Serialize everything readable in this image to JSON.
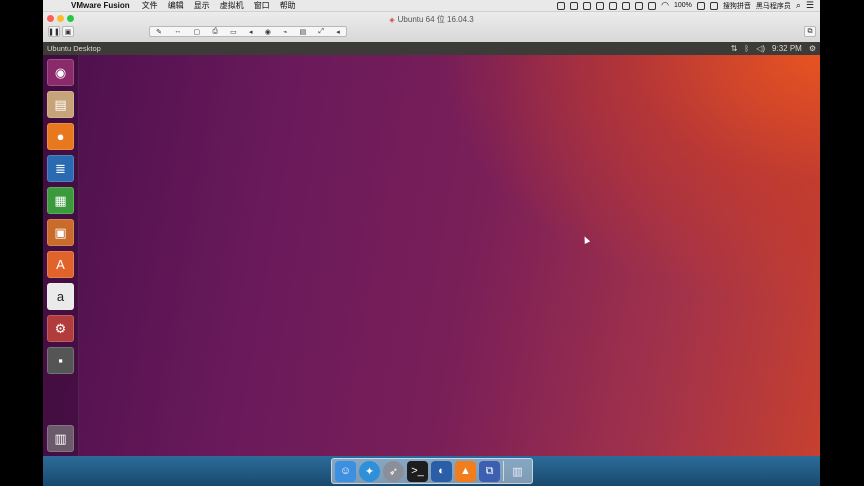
{
  "mac_menubar": {
    "apple_icon": "apple-icon",
    "app_name": "VMware Fusion",
    "menu_items": [
      "文件",
      "编辑",
      "显示",
      "虚拟机",
      "窗口",
      "帮助"
    ],
    "battery": "100%",
    "input_method": "搜狗拼音",
    "username": "黑马程序员"
  },
  "window": {
    "title": "Ubuntu 64 位 16.04.3"
  },
  "ubuntu_panel": {
    "title": "Ubuntu Desktop",
    "clock": "9:32 PM"
  },
  "launcher": {
    "items": [
      {
        "name": "dash-icon",
        "glyph": "◉",
        "bg": "#8a2a6a"
      },
      {
        "name": "files-icon",
        "glyph": "▤",
        "bg": "#c7a37a"
      },
      {
        "name": "firefox-icon",
        "glyph": "●",
        "bg": "#e8781e"
      },
      {
        "name": "writer-icon",
        "glyph": "≣",
        "bg": "#2a6ab0"
      },
      {
        "name": "calc-icon",
        "glyph": "▦",
        "bg": "#3b9a3b"
      },
      {
        "name": "impress-icon",
        "glyph": "▣",
        "bg": "#c96b2a"
      },
      {
        "name": "software-center-icon",
        "glyph": "A",
        "bg": "#e0632b"
      },
      {
        "name": "amazon-icon",
        "glyph": "a",
        "bg": "#eaeaea"
      },
      {
        "name": "system-settings-icon",
        "glyph": "⚙",
        "bg": "#b13c3c"
      },
      {
        "name": "disk-icon",
        "glyph": "▪",
        "bg": "#555555"
      },
      {
        "name": "trash-icon",
        "glyph": "🗑",
        "bg": "#6a5a6a"
      }
    ]
  },
  "dock": {
    "items": [
      "finder-icon",
      "safari-icon",
      "launchpad-icon",
      "terminal-icon",
      "preview-icon",
      "vlc-icon",
      "vmware-icon",
      "trash-icon"
    ]
  }
}
